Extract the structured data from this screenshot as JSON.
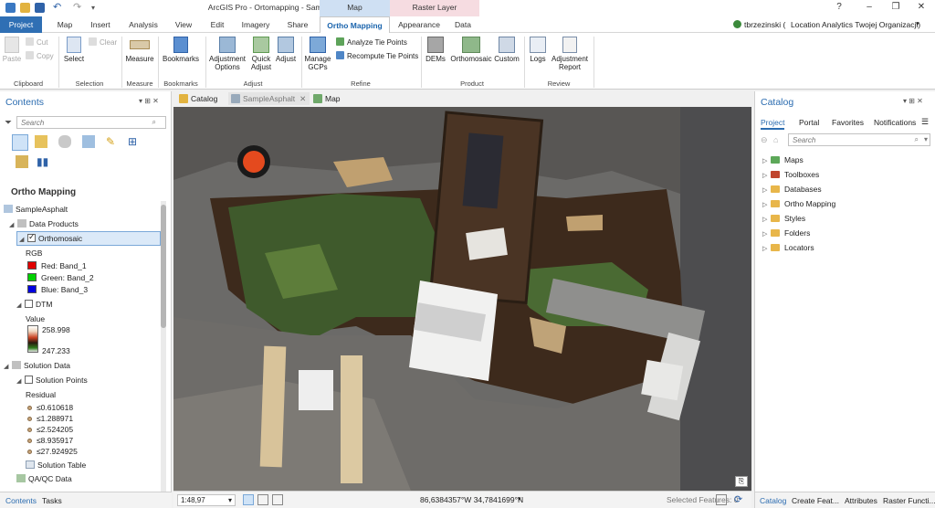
{
  "app": {
    "title": "ArcGIS Pro - Ortomapping - SampleAsphalt",
    "context_groups": [
      "Map",
      "Raster Layer"
    ],
    "window_controls": [
      "?",
      "–",
      "❐",
      "✕"
    ]
  },
  "ribbon_tabs": [
    "Project",
    "Map",
    "Insert",
    "Analysis",
    "View",
    "Edit",
    "Imagery",
    "Share",
    "Ortho Mapping",
    "Appearance",
    "Data"
  ],
  "user": {
    "name": "tbrzezinski (",
    "org": "Location Analytics Twojej Organizacji)"
  },
  "ribbon": {
    "clipboard": {
      "paste": "Paste",
      "cut": "Cut",
      "copy": "Copy",
      "label": "Clipboard"
    },
    "selection": {
      "select": "Select",
      "clear": "Clear",
      "label": "Selection"
    },
    "measure": {
      "measure": "Measure",
      "label": "Measure"
    },
    "bookmarks": {
      "bookmarks": "Bookmarks",
      "label": "Bookmarks"
    },
    "adjust": {
      "options": "Adjustment Options",
      "quick": "Quick Adjust",
      "adjust": "Adjust",
      "label": "Adjust"
    },
    "refine": {
      "manage": "Manage GCPs",
      "analyze": "Analyze Tie Points",
      "recompute": "Recompute Tie Points",
      "label": "Refine"
    },
    "product": {
      "dems": "DEMs",
      "ortho": "Orthomosaic",
      "custom": "Custom",
      "label": "Product"
    },
    "review": {
      "logs": "Logs",
      "report": "Adjustment Report",
      "label": "Review"
    }
  },
  "contents": {
    "title": "Contents",
    "search_placeholder": "Search",
    "section_title": "Ortho Mapping",
    "root": "SampleAsphalt",
    "data_products": "Data Products",
    "orthomosaic": "Orthomosaic",
    "rgb": "RGB",
    "bands": [
      {
        "label": "Red:  Band_1",
        "color": "#e00000"
      },
      {
        "label": "Green: Band_2",
        "color": "#00d000"
      },
      {
        "label": "Blue:  Band_3",
        "color": "#0000e0"
      }
    ],
    "dtm": "DTM",
    "value_label": "Value",
    "dtm_high": "258.998",
    "dtm_low": "247.233",
    "solution_data": "Solution Data",
    "solution_points": "Solution Points",
    "residual": "Residual",
    "residual_classes": [
      "≤0.610618",
      "≤1.288971",
      "≤2.524205",
      "≤8.935917",
      "≤27.924925"
    ],
    "solution_table": "Solution Table",
    "qaqc": "QA/QC Data",
    "bottom_tabs": [
      "Contents",
      "Tasks"
    ]
  },
  "doc_tabs": [
    "Catalog",
    "SampleAsphalt",
    "Map"
  ],
  "status": {
    "scale": "1:48,97",
    "coords": "86,6384357°W 34,7841699°N",
    "selected": "Selected Features: 0"
  },
  "catalog": {
    "title": "Catalog",
    "tabs": [
      "Project",
      "Portal",
      "Favorites",
      "Notifications"
    ],
    "search_placeholder": "Search",
    "items": [
      "Maps",
      "Toolboxes",
      "Databases",
      "Ortho Mapping",
      "Styles",
      "Folders",
      "Locators"
    ],
    "bottom_tabs": [
      "Catalog",
      "Create Feat...",
      "Attributes",
      "Raster Functi..."
    ]
  }
}
